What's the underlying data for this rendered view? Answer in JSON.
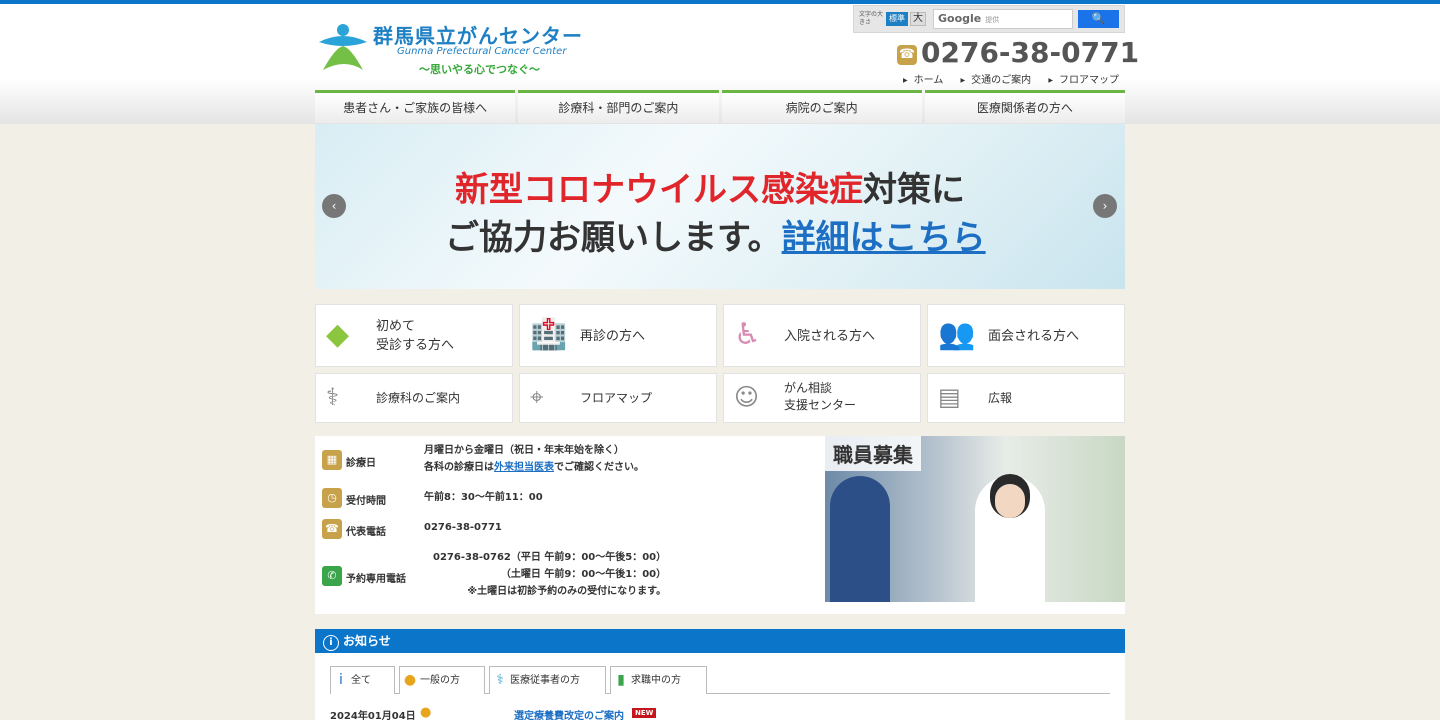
{
  "header": {
    "logo_title": "群馬県立がんセンター",
    "logo_english": "Gunma Prefectural Cancer Center",
    "logo_tagline": "〜思いやる心でつなぐ〜",
    "font_size_label": "文字の大きさ",
    "font_size_standard": "標準",
    "font_size_large": "大",
    "search_placeholder": "提供",
    "search_brand": "Google",
    "search_button": "🔍",
    "phone": "0276-38-0771",
    "util_nav": [
      "ホーム",
      "交通のご案内",
      "フロアマップ"
    ]
  },
  "global_nav": [
    "患者さん・ご家族の皆様へ",
    "診療科・部門のご案内",
    "病院のご案内",
    "医療関係者の方へ"
  ],
  "hero": {
    "line1_red": "新型コロナウイルス感染症",
    "line1_black": "対策に",
    "line2_black": "ご協力お願いします。",
    "line2_link": "詳細はこちら",
    "prev": "‹",
    "next": "›"
  },
  "tiles_big": [
    {
      "icon": "beginner-mark-icon",
      "line1": "初めて",
      "line2": "受診する方へ"
    },
    {
      "icon": "hospital-building-icon",
      "line1": "再診の方へ",
      "line2": ""
    },
    {
      "icon": "wheelchair-icon",
      "line1": "入院される方へ",
      "line2": ""
    },
    {
      "icon": "visitors-icon",
      "line1": "面会される方へ",
      "line2": ""
    }
  ],
  "tiles_small": [
    {
      "icon": "doctors-icon",
      "line1": "診療科のご案内",
      "line2": ""
    },
    {
      "icon": "map-pin-icon",
      "line1": "フロアマップ",
      "line2": ""
    },
    {
      "icon": "consultation-icon",
      "line1": "がん相談",
      "line2": "支援センター"
    },
    {
      "icon": "newsletter-icon",
      "line1": "広報",
      "line2": ""
    }
  ],
  "info": {
    "days_label": "診療日",
    "days_text1": "月曜日から金曜日（祝日・年末年始を除く）",
    "days_text2_prefix": "各科の診療日は",
    "days_text2_link": "外来担当医表",
    "days_text2_suffix": "でご確認ください。",
    "reception_label": "受付時間",
    "reception_text": "午前8：30〜午前11：00",
    "main_phone_label": "代表電話",
    "main_phone_text": "0276-38-0771",
    "reserve_label": "予約専用電話",
    "reserve_text1": "0276-38-0762（平日 午前9：00〜午後5：00）",
    "reserve_text2": "（土曜日 午前9：00〜午後1：00）",
    "reserve_text3": "※土曜日は初診予約のみの受付になります。"
  },
  "recruit": {
    "title": "職員募集"
  },
  "notices": {
    "title": "お知らせ",
    "tabs": [
      {
        "icon": "info-icon",
        "label": "全て"
      },
      {
        "icon": "person-icon",
        "label": "一般の方"
      },
      {
        "icon": "stethoscope-icon",
        "label": "医療従事者の方"
      },
      {
        "icon": "jobseeker-icon",
        "label": "求職中の方"
      }
    ],
    "items": [
      {
        "date": "2024年01月04日",
        "title": "選定療養費改定のご案内",
        "badge": "NEW"
      }
    ]
  },
  "colors": {
    "brand_blue": "#0b75c9",
    "nav_green": "#6bb545",
    "accent_gold": "#c8a24a",
    "alert_red": "#e0252b"
  }
}
